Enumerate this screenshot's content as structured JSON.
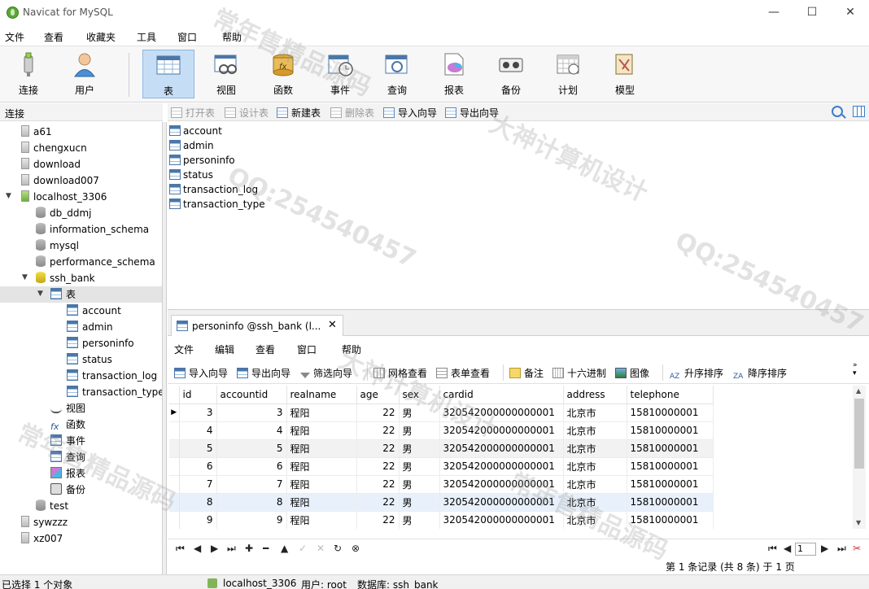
{
  "window": {
    "title": "Navicat for MySQL",
    "min": "—",
    "max": "☐",
    "close": "✕"
  },
  "menu": [
    "文件",
    "查看",
    "收藏夹",
    "工具",
    "窗口",
    "帮助"
  ],
  "toolbar": [
    "连接",
    "用户",
    "表",
    "视图",
    "函数",
    "事件",
    "查询",
    "报表",
    "备份",
    "计划",
    "模型"
  ],
  "left_header": "连接",
  "tree": {
    "connections_top": [
      "a61",
      "chengxucn",
      "download",
      "download007"
    ],
    "localhost": "localhost_3306",
    "databases": [
      "db_ddmj",
      "information_schema",
      "mysql",
      "performance_schema"
    ],
    "ssh_bank": "ssh_bank",
    "tables_folder": "表",
    "tables": [
      "account",
      "admin",
      "personinfo",
      "status",
      "transaction_log",
      "transaction_type"
    ],
    "other_folders": [
      "视图",
      "函数",
      "事件",
      "查询",
      "报表",
      "备份"
    ],
    "test": "test",
    "connections_bottom": [
      "sywzzz",
      "xz007"
    ]
  },
  "object_toolbar": [
    "打开表",
    "设计表",
    "新建表",
    "删除表",
    "导入向导",
    "导出向导"
  ],
  "object_list": [
    "account",
    "admin",
    "personinfo",
    "status",
    "transaction_log",
    "transaction_type"
  ],
  "tab": {
    "label": "personinfo @ssh_bank (l...",
    "close": "✕"
  },
  "editor_menu": [
    "文件",
    "编辑",
    "查看",
    "窗口",
    "帮助"
  ],
  "editor_toolbar": [
    "导入向导",
    "导出向导",
    "筛选向导",
    "网格查看",
    "表单查看",
    "备注",
    "十六进制",
    "图像",
    "升序排序",
    "降序排序"
  ],
  "grid": {
    "columns": [
      "id",
      "accountid",
      "realname",
      "age",
      "sex",
      "cardid",
      "address",
      "telephone"
    ],
    "rows": [
      [
        "3",
        "3",
        "程阳",
        "22",
        "男",
        "320542000000000001",
        "北京市",
        "15810000001"
      ],
      [
        "4",
        "4",
        "程阳",
        "22",
        "男",
        "320542000000000001",
        "北京市",
        "15810000001"
      ],
      [
        "5",
        "5",
        "程阳",
        "22",
        "男",
        "320542000000000001",
        "北京市",
        "15810000001"
      ],
      [
        "6",
        "6",
        "程阳",
        "22",
        "男",
        "320542000000000001",
        "北京市",
        "15810000001"
      ],
      [
        "7",
        "7",
        "程阳",
        "22",
        "男",
        "320542000000000001",
        "北京市",
        "15810000001"
      ],
      [
        "8",
        "8",
        "程阳",
        "22",
        "男",
        "320542000000000001",
        "北京市",
        "15810000001"
      ],
      [
        "9",
        "9",
        "程阳",
        "22",
        "男",
        "320542000000000001",
        "北京市",
        "15810000001"
      ]
    ]
  },
  "nav": {
    "first": "⏮",
    "prev": "◀",
    "next": "▶",
    "last": "⏭",
    "add": "✚",
    "delete": "━",
    "up": "▲",
    "apply": "✓",
    "cancel": "✕",
    "refresh": "↻",
    "stop": "⊗",
    "page": "1"
  },
  "pager": "第 1 条记录 (共 8 条) 于 1 页",
  "status": {
    "selection": "已选择 1 个对象",
    "connection": "localhost_3306",
    "user": "用户: root",
    "database": "数据库: ssh_bank"
  },
  "watermarks": [
    "常年售精品源码",
    "QQ:254540457",
    "大神计算机设计"
  ]
}
